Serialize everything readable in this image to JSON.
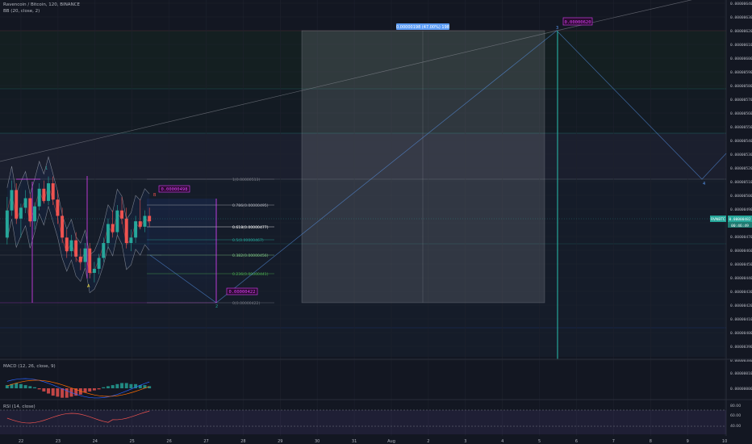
{
  "header": {
    "symbol_line": "Ravencoin / Bitcoin, 120, BINANCE",
    "indicator_bb": "BB (20, close, 2)"
  },
  "colors": {
    "background": "#131722",
    "up": "#26a69a",
    "down": "#ef5350",
    "magenta": "#e040fb",
    "grid": "#1e222d",
    "axis_text": "#b2b5be",
    "fib_0": "#787b86",
    "fib_236": "#4caf50",
    "fib_382": "#81c784",
    "fib_5": "#26a69a",
    "fib_618": "#2962ff",
    "fib_786": "#b2b5be",
    "fib_1": "#787b86"
  },
  "axis": {
    "price_ticks": [
      "0.00000640",
      "0.00000630",
      "0.00000620",
      "0.00000610",
      "0.00000600",
      "0.00000590",
      "0.00000580",
      "0.00000570",
      "0.00000560",
      "0.00000550",
      "0.00000540",
      "0.00000530",
      "0.00000520",
      "0.00000510",
      "0.00000500",
      "0.00000490",
      "0.00000480",
      "0.00000470",
      "0.00000460",
      "0.00000450",
      "0.00000440",
      "0.00000430",
      "0.00000420",
      "0.00000410",
      "0.00000400",
      "0.00000390",
      "0.00000380"
    ],
    "date_ticks": [
      "22",
      "23",
      "24",
      "25",
      "26",
      "27",
      "28",
      "29",
      "30",
      "31",
      "Aug",
      "2",
      "3",
      "4",
      "5",
      "6",
      "7",
      "8",
      "9",
      "10"
    ],
    "macd_ticks": [
      "0.00000010",
      "0.00000000"
    ],
    "rsi_ticks": [
      "80.00",
      "60.00",
      "40.00"
    ]
  },
  "chart_data": {
    "type": "candlestick",
    "symbol": "RVNBTC",
    "timeframe": "120",
    "exchange": "BINANCE",
    "ylim": [
      3.8e-06,
      6.4e-06
    ],
    "last_price": {
      "value": "0.00000482",
      "countdown": "00:46:49",
      "label": "RVNBTC"
    },
    "fibonacci": [
      {
        "level": "1(0.00000513)",
        "value": 5.13e-06
      },
      {
        "level": "0.786(0.00000495)",
        "value": 4.95e-06
      },
      {
        "level": "0.618(0.00000477)",
        "value": 4.77e-06
      },
      {
        "level": "0.5(0.00000467)",
        "value": 4.67e-06
      },
      {
        "level": "0.382(0.00000456)",
        "value": 4.56e-06
      },
      {
        "level": "0.236(0.00000441)",
        "value": 4.41e-06
      },
      {
        "level": "0(0.00000422)",
        "value": 4.22e-06
      }
    ],
    "callouts": [
      "0.00000498",
      "0.00000422",
      "0.00000620"
    ],
    "measure_label": "0.00000198 (47.00%) 198",
    "wave_labels": [
      "1",
      "A",
      "B",
      "2",
      "3",
      "4"
    ],
    "macd_label": "MACD (12, 26, close, 9)",
    "rsi_label": "RSI (14, close)",
    "candles": [
      [
        4.7e-06,
        5e-06,
        4.65e-06,
        4.9e-06
      ],
      [
        4.9e-06,
        5.12e-06,
        4.86e-06,
        5.05e-06
      ],
      [
        5.05e-06,
        5.1e-06,
        4.8e-06,
        4.84e-06
      ],
      [
        4.84e-06,
        4.95e-06,
        4.7e-06,
        4.92e-06
      ],
      [
        4.92e-06,
        5.05e-06,
        4.88e-06,
        4.99e-06
      ],
      [
        4.99e-06,
        5.02e-06,
        4.78e-06,
        4.82e-06
      ],
      [
        4.82e-06,
        4.96e-06,
        4.76e-06,
        4.93e-06
      ],
      [
        4.93e-06,
        5.1e-06,
        4.9e-06,
        5.06e-06
      ],
      [
        5.06e-06,
        5.12e-06,
        4.95e-06,
        4.97e-06
      ],
      [
        4.97e-06,
        5.15e-06,
        4.94e-06,
        5.1e-06
      ],
      [
        5.1e-06,
        5.15e-06,
        4.94e-06,
        4.98e-06
      ],
      [
        4.98e-06,
        5.05e-06,
        4.8e-06,
        4.86e-06
      ],
      [
        4.86e-06,
        4.92e-06,
        4.66e-06,
        4.7e-06
      ],
      [
        4.7e-06,
        4.76e-06,
        4.55e-06,
        4.6e-06
      ],
      [
        4.6e-06,
        4.72e-06,
        4.56e-06,
        4.68e-06
      ],
      [
        4.68e-06,
        4.74e-06,
        4.52e-06,
        4.56e-06
      ],
      [
        4.56e-06,
        4.62e-06,
        4.46e-06,
        4.52e-06
      ],
      [
        4.52e-06,
        4.66e-06,
        4.48e-06,
        4.62e-06
      ],
      [
        4.62e-06,
        4.66e-06,
        4.4e-06,
        4.44e-06
      ],
      [
        4.44e-06,
        4.52e-06,
        4.37e-06,
        4.47e-06
      ],
      [
        4.47e-06,
        4.58e-06,
        4.43e-06,
        4.55e-06
      ],
      [
        4.55e-06,
        4.7e-06,
        4.52e-06,
        4.66e-06
      ],
      [
        4.66e-06,
        4.84e-06,
        4.62e-06,
        4.8e-06
      ],
      [
        4.8e-06,
        4.9e-06,
        4.7e-06,
        4.74e-06
      ],
      [
        4.74e-06,
        4.94e-06,
        4.72e-06,
        4.9e-06
      ],
      [
        4.9e-06,
        5e-06,
        4.8e-06,
        4.84e-06
      ],
      [
        4.84e-06,
        4.92e-06,
        4.62e-06,
        4.66e-06
      ],
      [
        4.66e-06,
        4.76e-06,
        4.6e-06,
        4.7e-06
      ],
      [
        4.7e-06,
        4.86e-06,
        4.66e-06,
        4.82e-06
      ],
      [
        4.82e-06,
        4.98e-06,
        4.76e-06,
        4.78e-06
      ],
      [
        4.78e-06,
        4.9e-06,
        4.74e-06,
        4.86e-06
      ],
      [
        4.86e-06,
        4.92e-06,
        4.78e-06,
        4.82e-06
      ]
    ]
  }
}
